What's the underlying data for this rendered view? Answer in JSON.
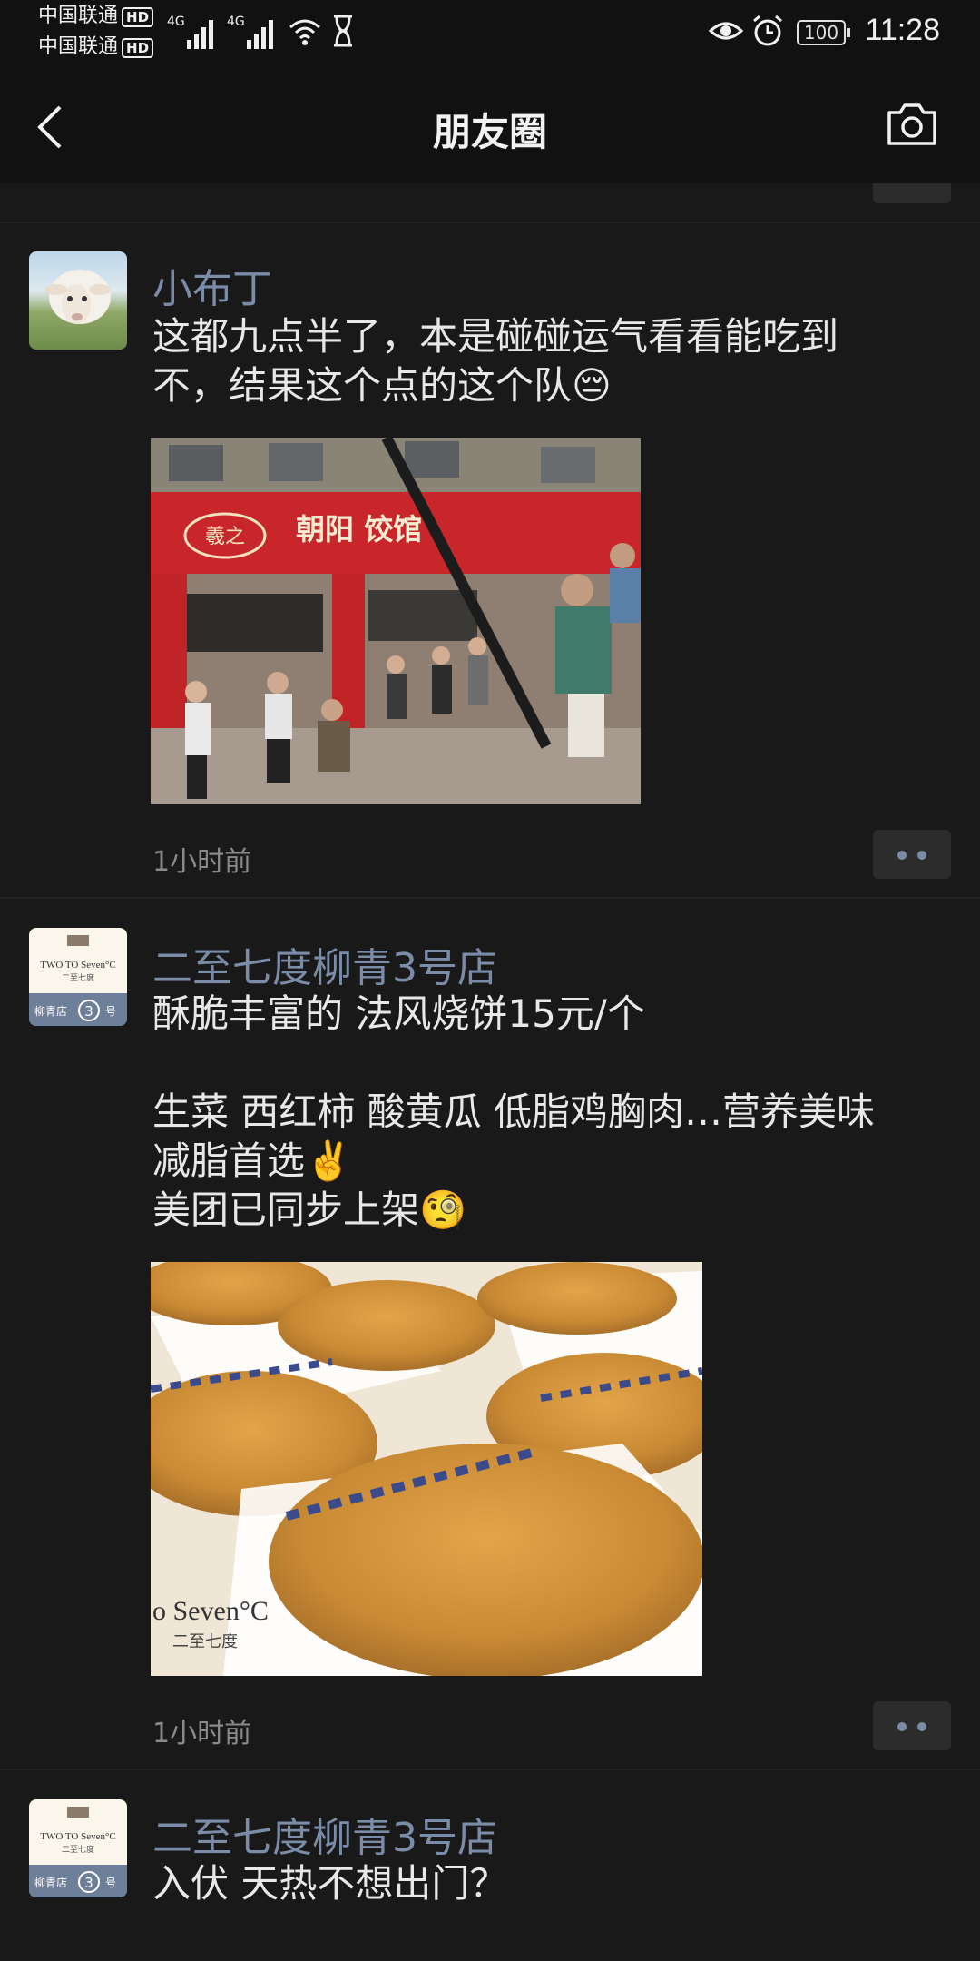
{
  "status_bar": {
    "carrier1": "中国联通",
    "carrier2": "中国联通",
    "hd": "HD",
    "net1": "4G",
    "net2": "4G",
    "battery": "100",
    "time": "11:28"
  },
  "nav": {
    "title": "朋友圈"
  },
  "posts": [
    {
      "author": "小布丁",
      "text_lines": [
        "这都九点半了，本是碰碰运气看看能吃到",
        "不，结果这个点的这个队😔"
      ],
      "time": "1小时前",
      "photo": {
        "sign_logo": "羲之",
        "sign_text": "朝阳 饺馆"
      }
    },
    {
      "author": "二至七度柳青3号店",
      "avatar": {
        "brand": "TWO TO Seven°C",
        "sub": "二至七度",
        "branch": "柳青店",
        "num": "3",
        "suffix": "号"
      },
      "text_lines": [
        "酥脆丰富的 法风烧饼15元/个",
        "",
        "生菜 西红柿 酸黄瓜 低脂鸡胸肉…营养美味",
        "减脂首选✌️",
        "美团已同步上架🧐"
      ],
      "time": "1小时前",
      "photo": {
        "watermark1": "o Seven°C",
        "watermark2": "二至七度"
      }
    },
    {
      "author": "二至七度柳青3号店",
      "avatar": {
        "brand": "TWO TO Seven°C",
        "sub": "二至七度",
        "branch": "柳青店",
        "num": "3",
        "suffix": "号"
      },
      "text_lines": [
        "入伏 天热不想出门？"
      ]
    }
  ],
  "colors": {
    "background": "#191919",
    "bar": "#111111",
    "author": "#7b8ca8"
  }
}
